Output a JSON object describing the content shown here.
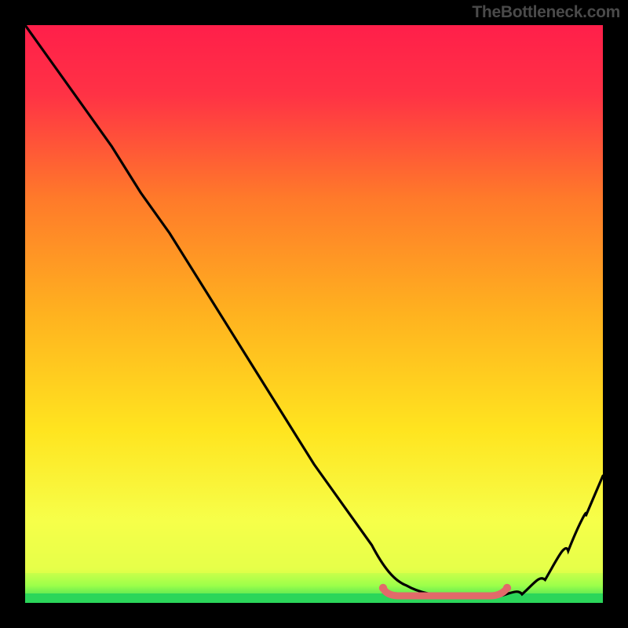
{
  "watermark": "TheBottleneck.com",
  "colors": {
    "curve": "#000000",
    "bottom_band": "#2bd65a",
    "yellow_band": "#f6ff4a",
    "cap_line": "#e26a6a",
    "frame_bg": "#000000"
  },
  "chart_data": {
    "type": "line",
    "title": "",
    "xlabel": "",
    "ylabel": "",
    "xlim": [
      0,
      100
    ],
    "ylim": [
      0,
      100
    ],
    "grid": false,
    "legend": false,
    "note": "No axis ticks or numeric labels are visible; x/y values below are normalized 0–100 estimates read from pixel position.",
    "series": [
      {
        "name": "bottleneck-curve",
        "x": [
          0,
          5,
          10,
          15,
          20,
          25,
          30,
          35,
          40,
          45,
          50,
          55,
          60,
          63,
          66,
          70,
          74,
          78,
          82,
          86,
          90,
          94,
          97,
          100
        ],
        "y": [
          100,
          93,
          86,
          79,
          71,
          64,
          56,
          48,
          40,
          32,
          24,
          17,
          10,
          6,
          3,
          1.2,
          0.6,
          0.5,
          0.6,
          1.5,
          4,
          9,
          15,
          22
        ]
      }
    ],
    "annotations": [
      {
        "name": "flat-valley-cap",
        "shape": "rounded-segment",
        "x_range": [
          62,
          82
        ],
        "y": 0.9
      }
    ],
    "background_gradient": {
      "top": "#ff1f4a",
      "mid": "#ffd21f",
      "low": "#f6ff4a",
      "bottom": "#2bd65a"
    }
  }
}
